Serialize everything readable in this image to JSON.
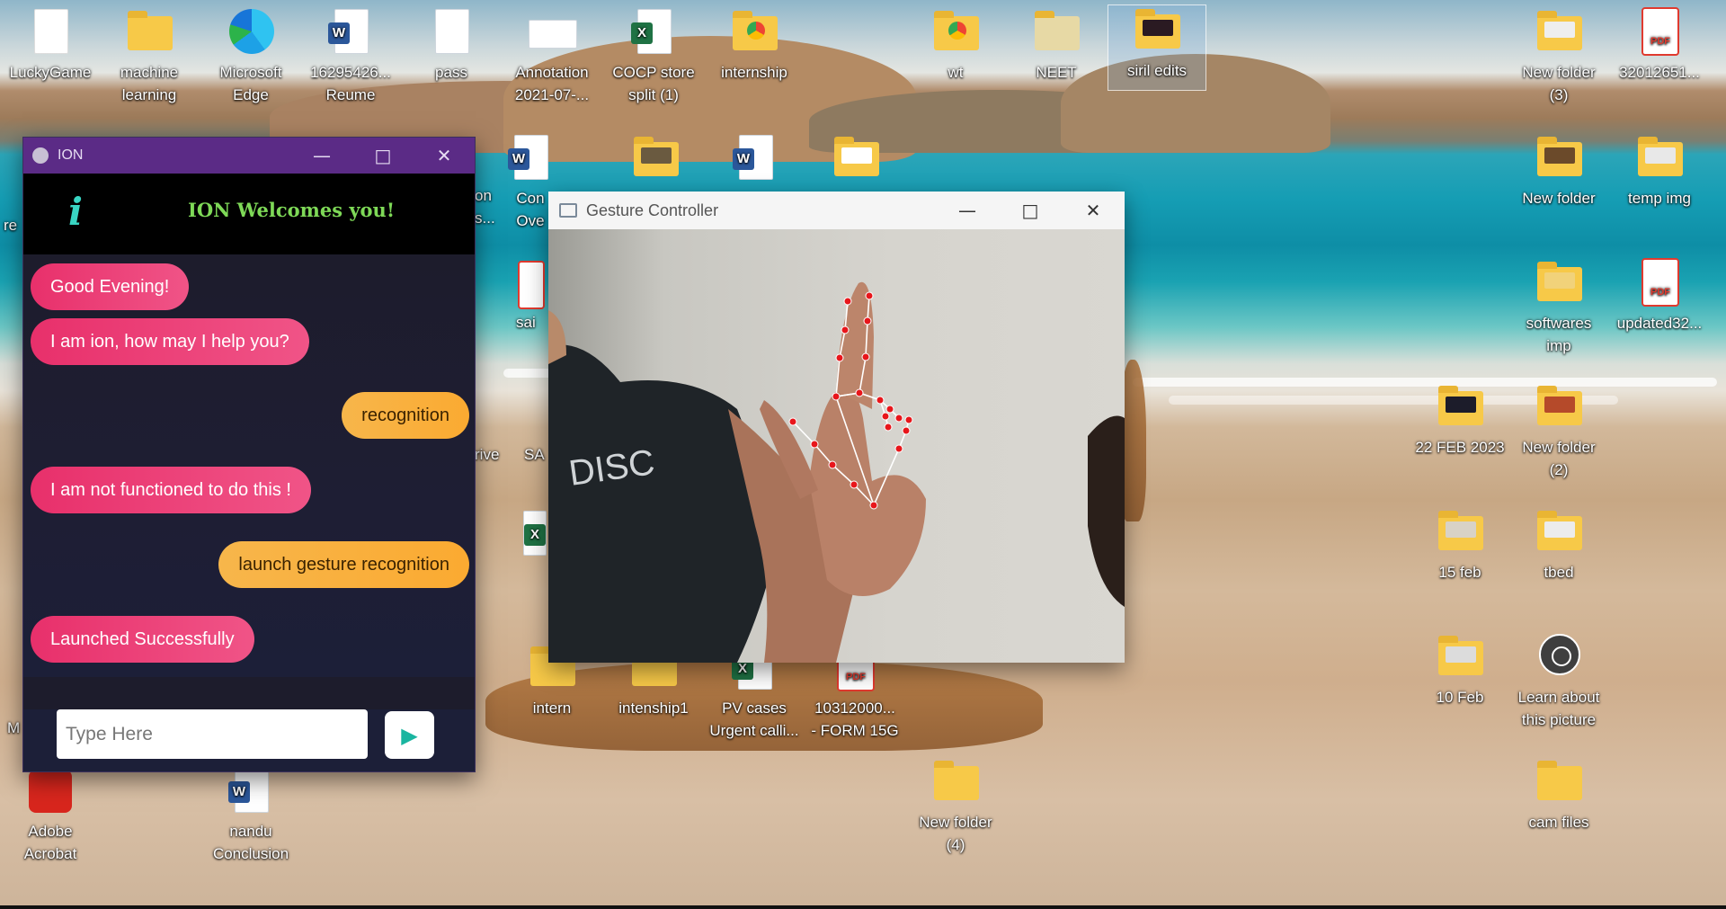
{
  "desktop_icons": {
    "lucky_game": "LuckyGame",
    "machine_learning": [
      "machine",
      "learning"
    ],
    "edge": [
      "Microsoft",
      "Edge"
    ],
    "reume": [
      "16295426...",
      "Reume"
    ],
    "pass": "pass",
    "annotation": [
      "Annotation",
      "2021-07-..."
    ],
    "cocp": [
      "COCP store",
      "split (1)"
    ],
    "internship": "internship",
    "wt": "wt",
    "neet": "NEET",
    "siril": "siril edits",
    "new_folder_3": [
      "New folder",
      "(3)"
    ],
    "pdf_32012651": "32012651...",
    "new_folder": "New folder",
    "temp_img": "temp img",
    "softwares": [
      "softwares",
      "imp"
    ],
    "updated32": "updated32...",
    "feb22": "22 FEB 2023",
    "new_folder_2": [
      "New folder",
      "(2)"
    ],
    "feb15": "15 feb",
    "tbed": "tbed",
    "feb10": "10 Feb",
    "learn_picture": [
      "Learn about",
      "this picture"
    ],
    "intern": "intern",
    "intenship1": "intenship1",
    "pv_cases": [
      "PV cases",
      "Urgent calli..."
    ],
    "form15g": [
      "10312000...",
      "- FORM 15G"
    ],
    "acrobat": [
      "Adobe",
      "Acrobat"
    ],
    "nandu": [
      "nandu",
      "Conclusion"
    ],
    "new_folder_4": [
      "New folder",
      "(4)"
    ],
    "cam_files": "cam files",
    "partial_on": [
      "on",
      "s..."
    ],
    "partial_con": [
      "Con",
      "Ove"
    ],
    "partial_sai": "sai",
    "partial_rive": "rive",
    "partial_sa": "SA",
    "partial_re": "re",
    "partial_m": "M"
  },
  "ion_window": {
    "title": "ION",
    "header_icon": "i",
    "welcome": "ION Welcomes you!",
    "messages": [
      {
        "from": "bot",
        "text": "Good Evening!"
      },
      {
        "from": "bot",
        "text": "I am ion, how may I help you?"
      },
      {
        "from": "user",
        "text": "recognition"
      },
      {
        "from": "bot",
        "text": "I am not functioned to do this !"
      },
      {
        "from": "user",
        "text": "launch gesture recognition"
      },
      {
        "from": "bot",
        "text": "Launched Successfully"
      }
    ],
    "input_placeholder": "Type Here",
    "send_icon": "play-triangle-icon"
  },
  "gesture_window": {
    "title": "Gesture Controller",
    "shirt_text": "DISC"
  },
  "colors": {
    "ion_titlebar": "#5b2b86",
    "bot_bubble": "#ec3a74",
    "user_bubble": "#f9b040",
    "welcome_text": "#7ed957",
    "landmark": "#e8161b"
  }
}
